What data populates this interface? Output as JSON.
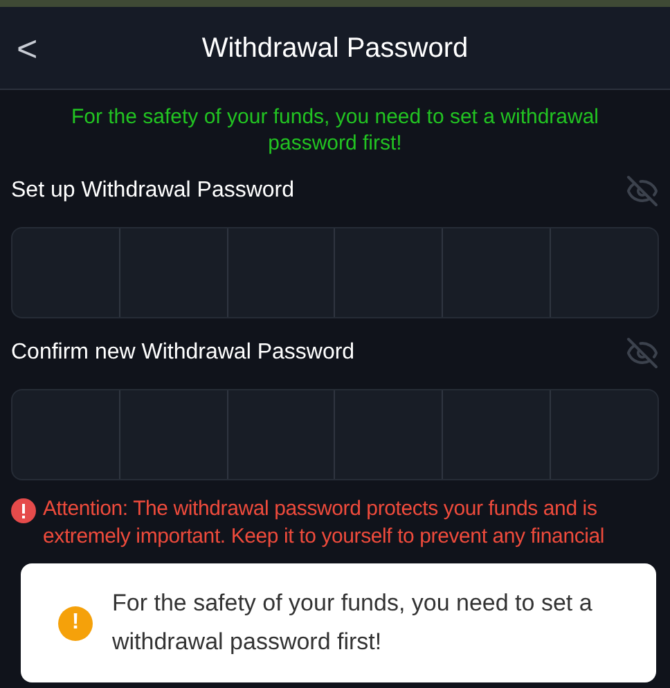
{
  "header": {
    "back": "<",
    "title": "Withdrawal Password"
  },
  "notice": "For the safety of your funds, you need to set a withdrawal password first!",
  "fields": [
    {
      "label": "Set up Withdrawal Password"
    },
    {
      "label": "Confirm new Withdrawal Password"
    }
  ],
  "attention": "Attention: The withdrawal password protects your funds and is extremely important. Keep it to yourself to prevent any financial",
  "toast": {
    "icon": "!",
    "message": "For the safety of your funds, you need to set a withdrawal password first!"
  }
}
